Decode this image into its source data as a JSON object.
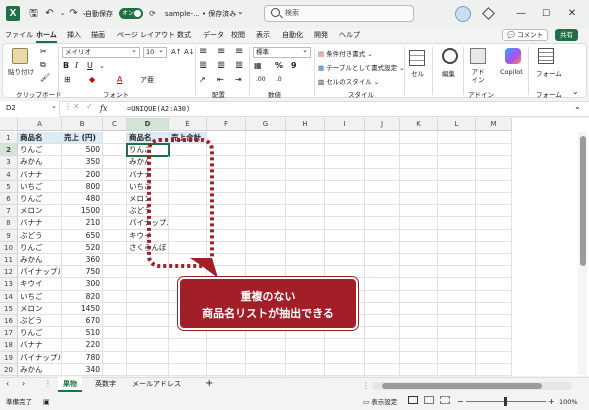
{
  "titlebar": {
    "autosave_label": "自動保存",
    "autosave_state": "オン",
    "filename": "sample-... • 保存済み",
    "search_placeholder": "検索"
  },
  "tabs": [
    "ファイル",
    "ホーム",
    "挿入",
    "描画",
    "ページ レイアウト",
    "数式",
    "データ",
    "校閲",
    "表示",
    "自動化",
    "開発",
    "ヘルプ"
  ],
  "active_tab": "ホーム",
  "comment_btn": "コメント",
  "share_btn": "共有",
  "ribbon": {
    "font_name": "メイリオ",
    "font_size": "10",
    "number_format": "標準",
    "paste": "貼り付け",
    "clipboard": "クリップボード",
    "font": "フォント",
    "alignment": "配置",
    "number": "数値",
    "styles": "スタイル",
    "cells": "セル",
    "editing": "編集",
    "addins": "アドイン",
    "addins_group": "アドイン",
    "copilot": "Copilot",
    "forms": "フォーム",
    "forms_group": "フォーム",
    "cond_format": "条件付き書式",
    "as_table": "テーブルとして書式設定",
    "cell_styles": "セルのスタイル"
  },
  "formula_bar": {
    "name_box": "D2",
    "fx": "fx",
    "formula": "=UNIQUE(A2:A30)"
  },
  "columns": [
    "A",
    "B",
    "C",
    "D",
    "E",
    "F",
    "G",
    "H",
    "I",
    "J",
    "K",
    "L",
    "M"
  ],
  "rows": [
    "1",
    "2",
    "3",
    "4",
    "5",
    "6",
    "7",
    "8",
    "9",
    "10",
    "11",
    "12",
    "13",
    "14",
    "15",
    "16",
    "17",
    "18",
    "19",
    "20",
    "21"
  ],
  "header_row": {
    "a": "商品名",
    "b": "売上 (円)",
    "d": "商品名",
    "e": "売上合計"
  },
  "data": [
    {
      "name": "りんご",
      "sales": "500"
    },
    {
      "name": "みかん",
      "sales": "350"
    },
    {
      "name": "バナナ",
      "sales": "200"
    },
    {
      "name": "いちご",
      "sales": "800"
    },
    {
      "name": "りんご",
      "sales": "480"
    },
    {
      "name": "メロン",
      "sales": "1500"
    },
    {
      "name": "バナナ",
      "sales": "210"
    },
    {
      "name": "ぶどう",
      "sales": "650"
    },
    {
      "name": "りんご",
      "sales": "520"
    },
    {
      "name": "みかん",
      "sales": "360"
    },
    {
      "name": "パイナップル",
      "sales": "750"
    },
    {
      "name": "キウイ",
      "sales": "300"
    },
    {
      "name": "いちご",
      "sales": "820"
    },
    {
      "name": "メロン",
      "sales": "1450"
    },
    {
      "name": "ぶどう",
      "sales": "670"
    },
    {
      "name": "りんご",
      "sales": "510"
    },
    {
      "name": "バナナ",
      "sales": "220"
    },
    {
      "name": "パイナップル",
      "sales": "780"
    },
    {
      "name": "みかん",
      "sales": "340"
    },
    {
      "name": "",
      "sales": ""
    }
  ],
  "unique": [
    "りんご",
    "みかん",
    "バナナ",
    "いちご",
    "メロン",
    "ぶどう",
    "パイナップル",
    "キウイ",
    "さくらんぼ"
  ],
  "callout": {
    "line1": "重複のない",
    "line2": "商品名リストが抽出できる"
  },
  "sheets": [
    "果物",
    "英数字",
    "メールアドレス"
  ],
  "add_sheet": "+",
  "status": {
    "ready": "準備完了",
    "display_settings": "表示設定",
    "zoom": "100%"
  },
  "accent": "#1e7145",
  "callout_color": "#a21f27"
}
